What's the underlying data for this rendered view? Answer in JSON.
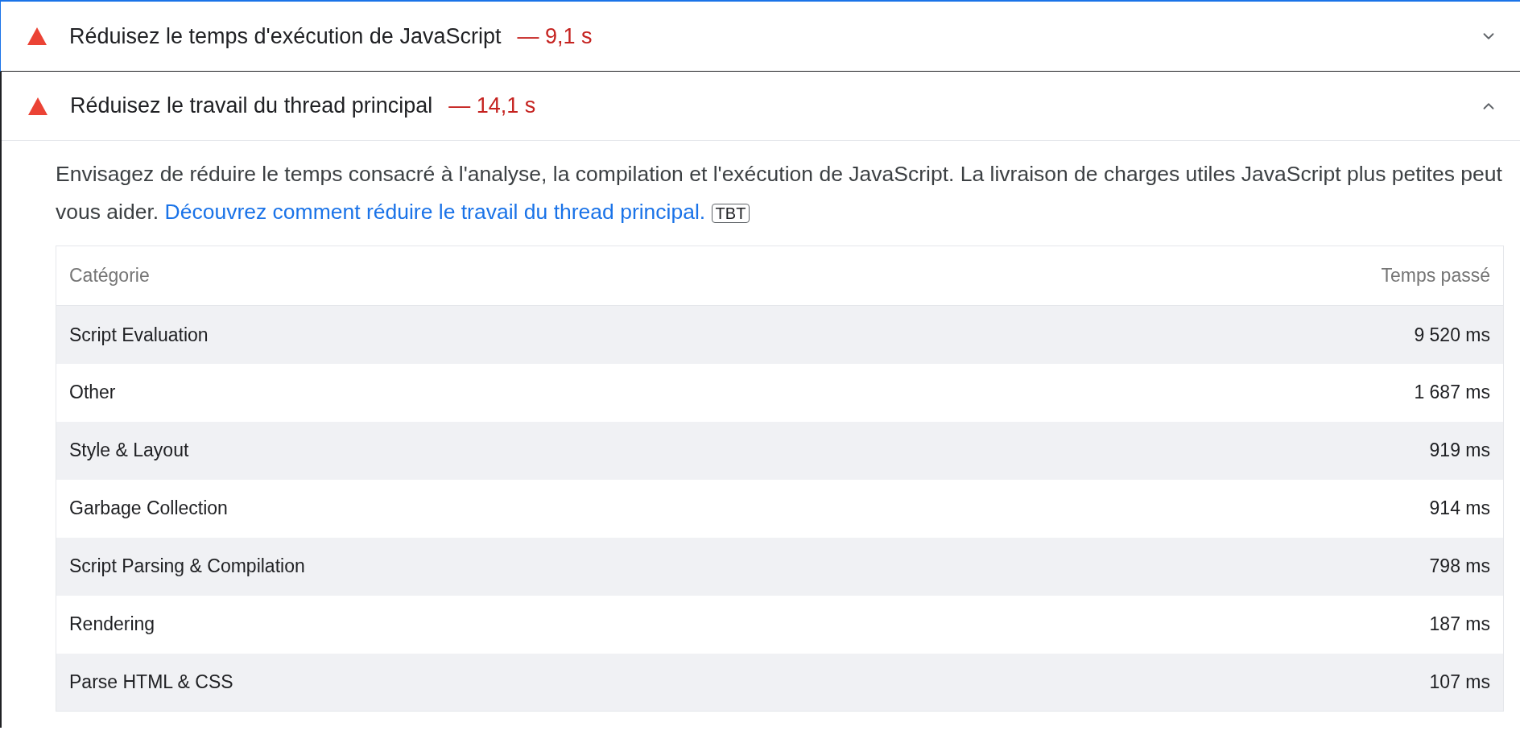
{
  "audits": [
    {
      "title": "Réduisez le temps d'exécution de JavaScript",
      "display_value": "— 9,1 s",
      "kind": "fail",
      "expanded": false,
      "focused": true
    },
    {
      "title": "Réduisez le travail du thread principal",
      "display_value": "— 14,1 s",
      "kind": "fail",
      "expanded": true,
      "focused": false,
      "description": "Envisagez de réduire le temps consacré à l'analyse, la compilation et l'exécution de JavaScript. La livraison de charges utiles JavaScript plus petites peut vous aider.",
      "link": "Découvrez comment réduire le travail du thread principal.",
      "badge": "TBT",
      "table": {
        "columns": [
          "Catégorie",
          "Temps passé"
        ],
        "rows": [
          [
            "Script Evaluation",
            "9 520 ms"
          ],
          [
            "Other",
            "1 687 ms"
          ],
          [
            "Style & Layout",
            "919 ms"
          ],
          [
            "Garbage Collection",
            "914 ms"
          ],
          [
            "Script Parsing & Compilation",
            "798 ms"
          ],
          [
            "Rendering",
            "187 ms"
          ],
          [
            "Parse HTML & CSS",
            "107 ms"
          ]
        ]
      }
    }
  ]
}
